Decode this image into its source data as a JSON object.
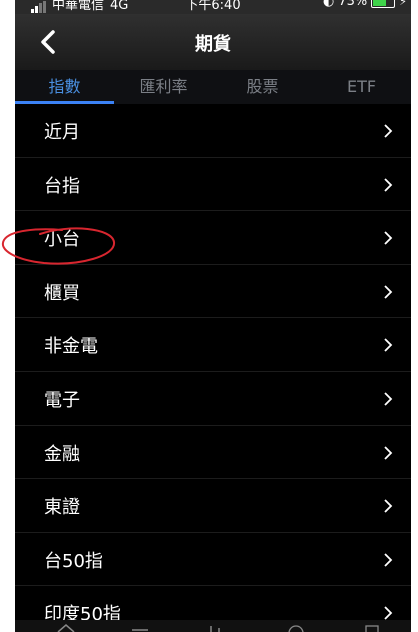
{
  "status_bar": {
    "carrier": "中華電信",
    "network": "4G",
    "time": "下午6:40",
    "battery": "73%",
    "battery_level": 0.73
  },
  "header": {
    "title": "期貨",
    "back_icon": "chevron-left-icon"
  },
  "tabs": [
    {
      "label": "指數",
      "active": true
    },
    {
      "label": "匯利率",
      "active": false
    },
    {
      "label": "股票",
      "active": false
    },
    {
      "label": "ETF",
      "active": false
    }
  ],
  "list": {
    "items": [
      {
        "label": "近月"
      },
      {
        "label": "台指"
      },
      {
        "label": "小台"
      },
      {
        "label": "櫃買"
      },
      {
        "label": "非金電"
      },
      {
        "label": "電子"
      },
      {
        "label": "金融"
      },
      {
        "label": "東證"
      },
      {
        "label": "台50指"
      },
      {
        "label": "印度50指"
      }
    ],
    "chevron_icon": "chevron-right-icon"
  },
  "colors": {
    "accent": "#3b82f6",
    "annotation": "#d8262f",
    "background": "#000000"
  }
}
